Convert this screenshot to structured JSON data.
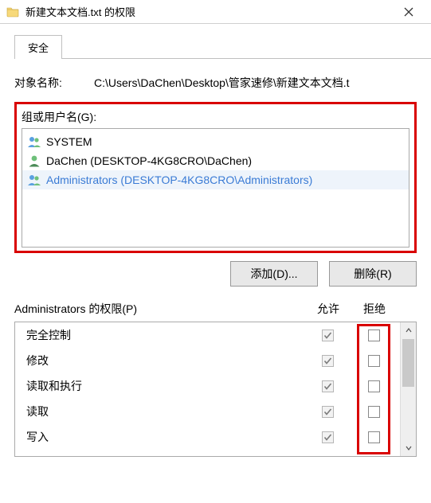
{
  "window": {
    "title": "新建文本文档.txt 的权限"
  },
  "tabs": {
    "active": "安全"
  },
  "object": {
    "label": "对象名称:",
    "value": "C:\\Users\\DaChen\\Desktop\\管家速修\\新建文本文档.t"
  },
  "group": {
    "label": "组或用户名(G):",
    "items": [
      {
        "name": "SYSTEM",
        "icon": "group"
      },
      {
        "name": "DaChen (DESKTOP-4KG8CRO\\DaChen)",
        "icon": "user"
      },
      {
        "name": "Administrators (DESKTOP-4KG8CRO\\Administrators)",
        "icon": "group",
        "selected": true
      }
    ]
  },
  "buttons": {
    "add": "添加(D)...",
    "remove": "删除(R)"
  },
  "permissions": {
    "title": "Administrators 的权限(P)",
    "allow_col": "允许",
    "deny_col": "拒绝",
    "rows": [
      {
        "label": "完全控制",
        "allow": true,
        "allow_disabled": true,
        "deny": false
      },
      {
        "label": "修改",
        "allow": true,
        "allow_disabled": true,
        "deny": false
      },
      {
        "label": "读取和执行",
        "allow": true,
        "allow_disabled": true,
        "deny": false
      },
      {
        "label": "读取",
        "allow": true,
        "allow_disabled": true,
        "deny": false
      },
      {
        "label": "写入",
        "allow": true,
        "allow_disabled": true,
        "deny": false
      }
    ]
  },
  "colors": {
    "highlight": "#d90000"
  }
}
